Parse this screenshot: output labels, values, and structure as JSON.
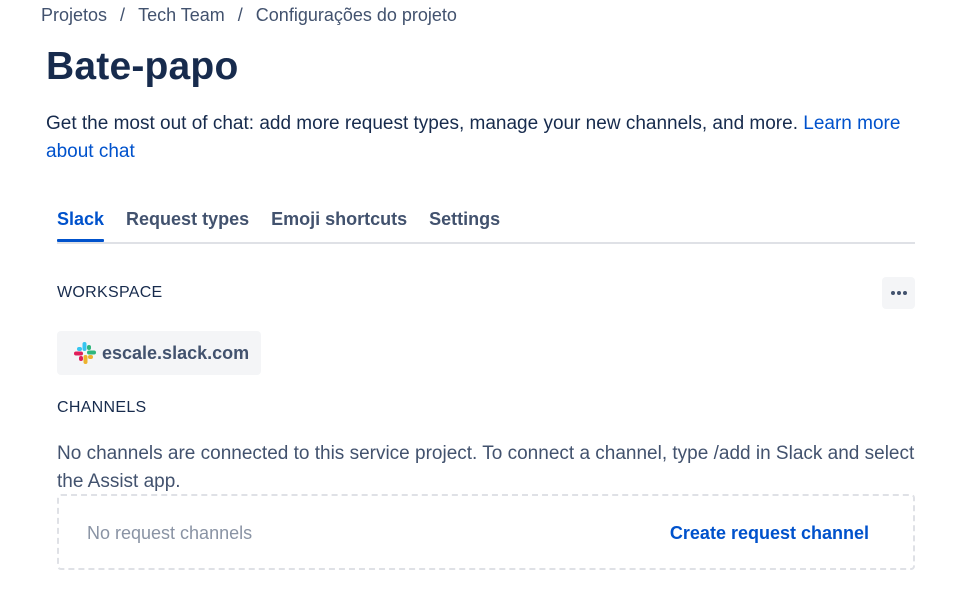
{
  "breadcrumb": {
    "items": [
      "Projetos",
      "Tech Team",
      "Configurações do projeto"
    ],
    "separator": "/"
  },
  "page": {
    "title": "Bate-papo",
    "intro_text": "Get the most out of chat: add more request types, manage your new channels, and more.",
    "intro_link": "Learn more about chat"
  },
  "tabs": [
    {
      "label": "Slack",
      "active": true
    },
    {
      "label": "Request types",
      "active": false
    },
    {
      "label": "Emoji shortcuts",
      "active": false
    },
    {
      "label": "Settings",
      "active": false
    }
  ],
  "workspace": {
    "heading": "WORKSPACE",
    "name": "escale.slack.com",
    "icon": "slack-logo-icon",
    "more_icon": "more-horizontal-icon"
  },
  "channels": {
    "heading": "CHANNELS",
    "description": "No channels are connected to this service project. To connect a channel, type /add in Slack and select the Assist app.",
    "empty_text": "No request channels",
    "create_label": "Create request channel"
  },
  "colors": {
    "accent": "#0052CC",
    "text_primary": "#172B4D",
    "text_secondary": "#42526E",
    "muted": "#8993A4",
    "chip_bg": "#F4F5F7",
    "border": "#DFE1E6"
  }
}
